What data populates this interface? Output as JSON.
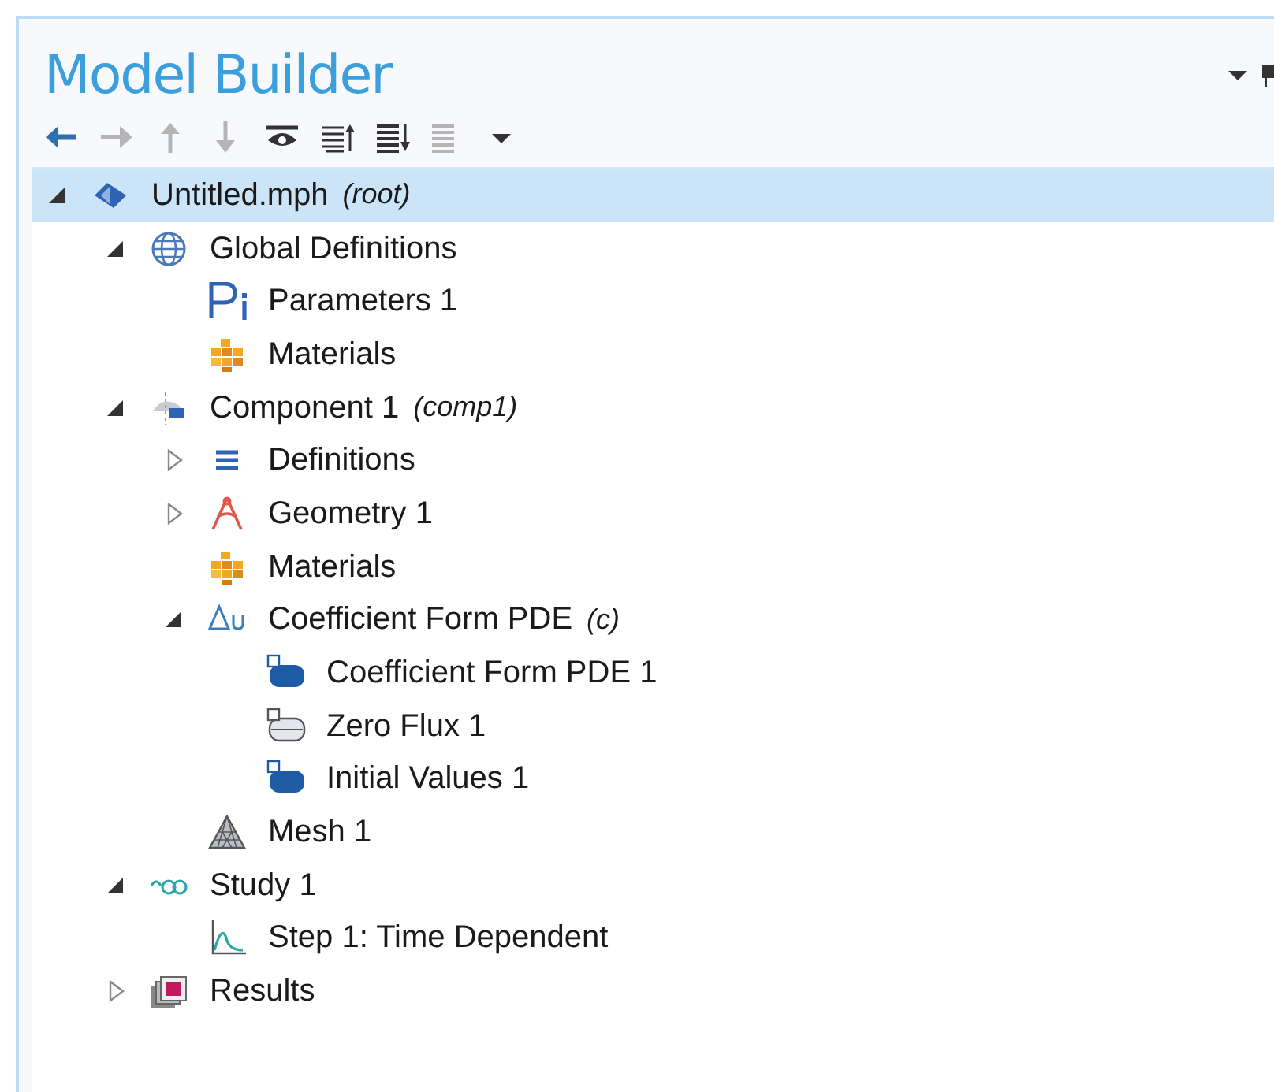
{
  "panel": {
    "title": "Model Builder"
  },
  "toolbar": [
    {
      "kind": "back",
      "disabled": false
    },
    {
      "kind": "forward",
      "disabled": true
    },
    {
      "kind": "up",
      "disabled": true
    },
    {
      "kind": "down",
      "disabled": true
    },
    {
      "kind": "show",
      "disabled": false
    },
    {
      "kind": "collapse",
      "disabled": false
    },
    {
      "kind": "expand",
      "disabled": false
    },
    {
      "kind": "list",
      "disabled": true
    },
    {
      "kind": "menu",
      "disabled": false
    }
  ],
  "tree": [
    {
      "kind": "root",
      "label": "Untitled.mph",
      "note": "(root)",
      "expanded": true,
      "selected": true,
      "children": [
        {
          "kind": "globe",
          "label": "Global Definitions",
          "expanded": true,
          "selected": false,
          "children": [
            {
              "kind": "parameters",
              "label": "Parameters 1",
              "selected": false
            },
            {
              "kind": "materials",
              "label": "Materials",
              "selected": false
            }
          ]
        },
        {
          "kind": "component",
          "label": "Component 1",
          "note": "(comp1)",
          "expanded": true,
          "selected": false,
          "children": [
            {
              "kind": "definitions",
              "label": "Definitions",
              "expanded": false,
              "selected": false
            },
            {
              "kind": "geometry",
              "label": "Geometry 1",
              "expanded": false,
              "selected": false
            },
            {
              "kind": "materials",
              "label": "Materials",
              "selected": false
            },
            {
              "kind": "physics",
              "label": "Coefficient Form PDE",
              "note": "(c)",
              "expanded": true,
              "selected": false,
              "children": [
                {
                  "kind": "domain",
                  "label": "Coefficient Form PDE 1",
                  "selected": false
                },
                {
                  "kind": "boundary",
                  "label": "Zero Flux 1",
                  "selected": false
                },
                {
                  "kind": "domain",
                  "label": "Initial Values 1",
                  "selected": false
                }
              ]
            },
            {
              "kind": "mesh",
              "label": "Mesh 1",
              "selected": false
            }
          ]
        },
        {
          "kind": "study",
          "label": "Study 1",
          "expanded": true,
          "selected": false,
          "children": [
            {
              "kind": "step",
              "label": "Step 1: Time Dependent",
              "selected": false
            }
          ]
        },
        {
          "kind": "results",
          "label": "Results",
          "expanded": false,
          "selected": false
        }
      ]
    }
  ]
}
